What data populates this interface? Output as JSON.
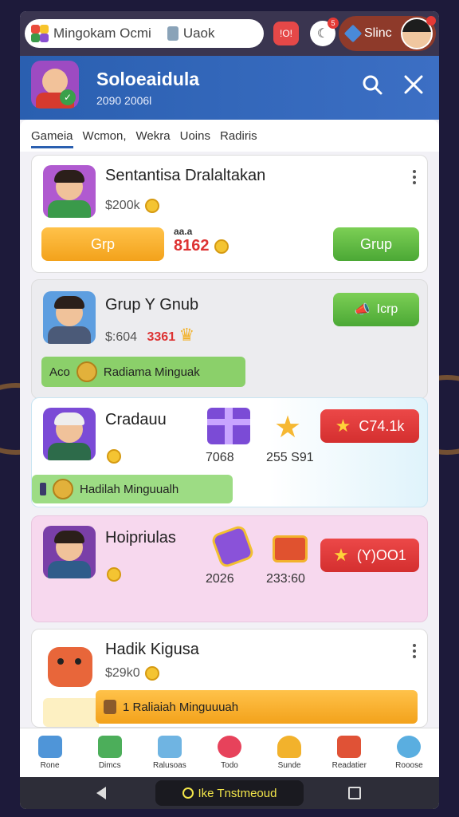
{
  "topbar": {
    "search_text": "Mingokam Ocmi",
    "search_secondary": "Uaok",
    "notif_red_label": "!O!",
    "notif_badge": "5",
    "store_label": "Slinc"
  },
  "header": {
    "title": "Soloeaidula",
    "subtitle": "2090 2006l"
  },
  "tabs": [
    "Gameia",
    "Wcmon,",
    "Wekra",
    "Uoins",
    "Radiris"
  ],
  "cards": [
    {
      "title": "Sentantisa Dralaltakan",
      "price": "$200k",
      "left_button": "Grp",
      "value": "8162",
      "value_top": "aa.a",
      "right_button": "Grup"
    },
    {
      "title": "Grup Y Gnub",
      "price": "$:604",
      "price_red": "3361",
      "right_button": "Icrp",
      "strip_prefix": "Aco",
      "strip_text": "Radiama Minguak"
    },
    {
      "title": "Cradauu",
      "gift_value": "7068",
      "star_value": "255 S91",
      "right_button": "C74.1k",
      "strip_text": "Hadilah Minguualh"
    },
    {
      "title": "Hoipriulas",
      "gift_value": "2026",
      "star_value": "233:60",
      "right_button": "(Y)OO1"
    },
    {
      "title": "Hadik Kigusa",
      "price": "$29k0",
      "strip_text": "1 Raliaiah Minguuuah"
    }
  ],
  "bottom_nav": [
    {
      "label": "Rone",
      "icon": "home-icon",
      "color": "#4f95d8"
    },
    {
      "label": "Dimcs",
      "icon": "map-icon",
      "color": "#4cae5a"
    },
    {
      "label": "Ralusoas",
      "icon": "box-icon",
      "color": "#6fb4e2"
    },
    {
      "label": "Todo",
      "icon": "color-wheel-icon",
      "color": "#e7425b"
    },
    {
      "label": "Sunde",
      "icon": "bell-icon",
      "color": "#f2b22c"
    },
    {
      "label": "Readatier",
      "icon": "chest-icon",
      "color": "#e05236"
    },
    {
      "label": "Rooose",
      "icon": "cloud-icon",
      "color": "#5aaee0"
    }
  ],
  "system_bar": {
    "center_label": "Ike Tnstmeoud"
  },
  "colors": {
    "header_blue": "#2a5fb0",
    "orange": "#f3a21b",
    "green": "#4ba835",
    "red": "#d42f2f"
  }
}
